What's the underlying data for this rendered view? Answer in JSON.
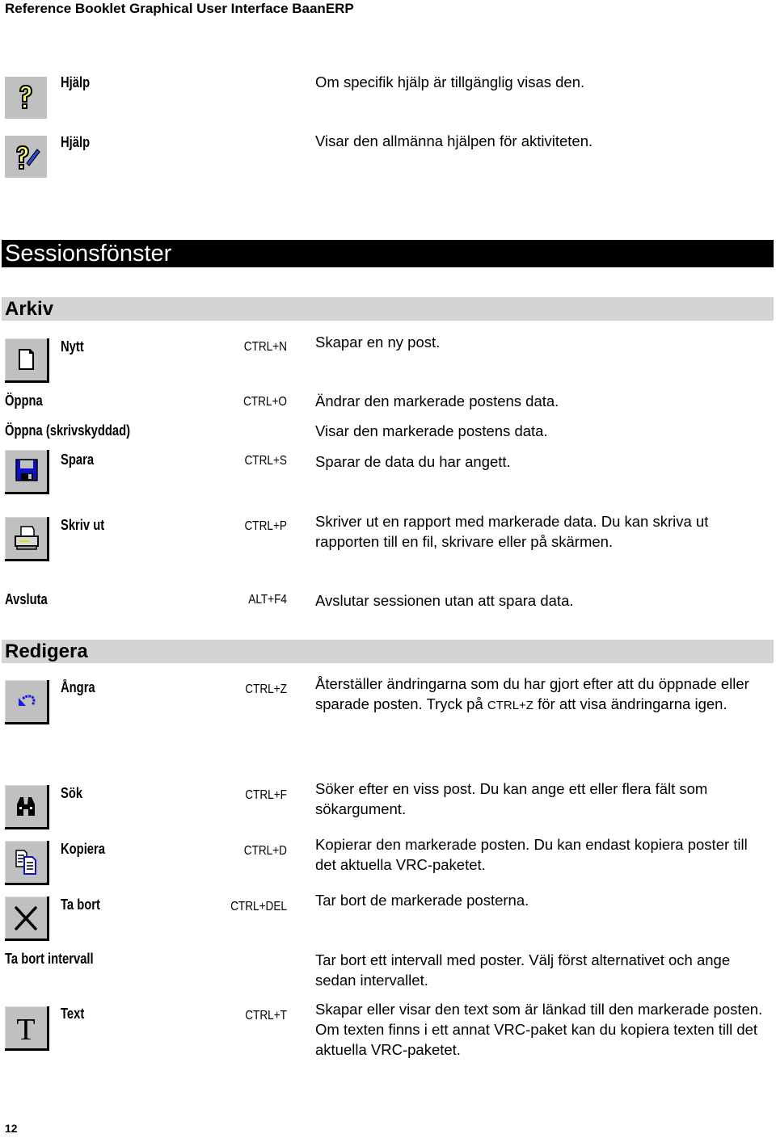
{
  "header": {
    "title": "Reference Booklet Graphical User Interface BaanERP"
  },
  "help_items": [
    {
      "icon": "help-question-icon",
      "label": "Hjälp",
      "description": "Om specifik hjälp är tillgänglig visas den."
    },
    {
      "icon": "help-context-icon",
      "label": "Hjälp",
      "description": "Visar den allmänna hjälpen för aktiviteten."
    }
  ],
  "section": {
    "title": "Sessionsfönster"
  },
  "arkiv": {
    "title": "Arkiv",
    "items": [
      {
        "icon": "new-document-icon",
        "label": "Nytt",
        "shortcut": "CTRL+N",
        "description": "Skapar en ny post."
      },
      {
        "icon": "",
        "label": "Öppna",
        "shortcut": "CTRL+O",
        "description": "Ändrar den markerade postens data."
      },
      {
        "icon": "",
        "label": "Öppna (skrivskyddad)",
        "shortcut": "",
        "description": "Visar den markerade postens data."
      },
      {
        "icon": "save-disk-icon",
        "label": "Spara",
        "shortcut": "CTRL+S",
        "description": "Sparar de data du har angett."
      },
      {
        "icon": "printer-icon",
        "label": "Skriv ut",
        "shortcut": "CTRL+P",
        "description": "Skriver ut en rapport med markerade data. Du kan skriva ut rapporten till en fil, skrivare eller på skärmen."
      },
      {
        "icon": "",
        "label": "Avsluta",
        "shortcut": "ALT+F4",
        "description": "Avslutar sessionen utan att spara data."
      }
    ]
  },
  "redigera": {
    "title": "Redigera",
    "items": [
      {
        "icon": "undo-arrow-icon",
        "label": "Ångra",
        "shortcut": "CTRL+Z",
        "description_pre": "Återställer ändringarna som du har gjort efter att du öppnade eller sparade posten. Tryck på ",
        "description_kbd": "CTRL+Z",
        "description_post": " för att visa ändringarna igen."
      },
      {
        "icon": "binoculars-icon",
        "label": "Sök",
        "shortcut": "CTRL+F",
        "description": "Söker efter en viss post. Du kan ange ett eller flera fält som sökargument."
      },
      {
        "icon": "copy-documents-icon",
        "label": "Kopiera",
        "shortcut": "CTRL+D",
        "description": "Kopierar den markerade posten. Du kan endast kopiera poster till det aktuella VRC-paketet."
      },
      {
        "icon": "delete-x-icon",
        "label": "Ta bort",
        "shortcut": "CTRL+DEL",
        "description": "Tar bort de markerade posterna."
      },
      {
        "icon": "",
        "label": "Ta bort intervall",
        "shortcut": "",
        "description": "Tar bort ett intervall med poster. Välj först alternativet och ange sedan intervallet."
      },
      {
        "icon": "text-t-icon",
        "label": "Text",
        "shortcut": "CTRL+T",
        "description": "Skapar eller visar den text som är länkad till den markerade posten. Om texten finns i ett annat VRC-paket kan du kopiera texten till det aktuella VRC-paketet."
      }
    ]
  },
  "footer": {
    "page_number": "12"
  }
}
